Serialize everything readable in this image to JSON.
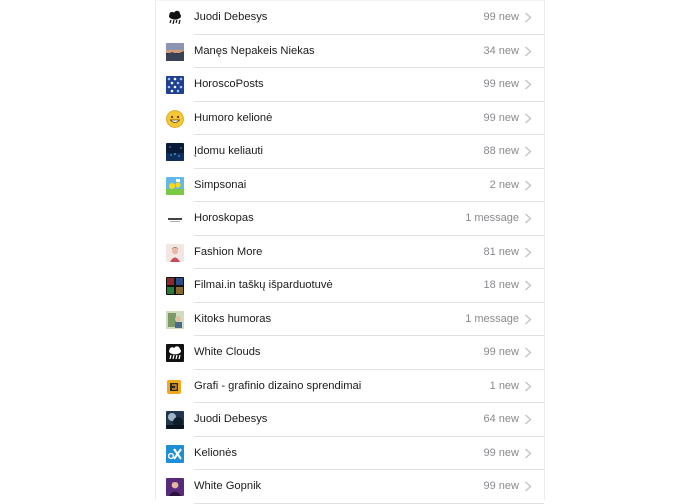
{
  "groups": [
    {
      "title": "Juodi Debesys",
      "count": "99 new",
      "icon": "rain-cloud-icon"
    },
    {
      "title": "Manęs Nepakeis Niekas",
      "count": "34 new",
      "icon": "landscape-icon"
    },
    {
      "title": "HoroscoPosts",
      "count": "99 new",
      "icon": "zodiac-pattern-icon"
    },
    {
      "title": "Humoro kelionė",
      "count": "99 new",
      "icon": "smiley-icon"
    },
    {
      "title": "Įdomu keliauti",
      "count": "88 new",
      "icon": "night-city-icon"
    },
    {
      "title": "Simpsonai",
      "count": "2 new",
      "icon": "simpsons-icon"
    },
    {
      "title": "Horoskopas",
      "count": "1 message",
      "icon": "horoskopas-logo-icon"
    },
    {
      "title": "Fashion More",
      "count": "81 new",
      "icon": "fashion-icon"
    },
    {
      "title": "Filmai.in taškų išparduotuvė",
      "count": "18 new",
      "icon": "movie-grid-icon"
    },
    {
      "title": "Kitoks humoras",
      "count": "1 message",
      "icon": "meme-icon"
    },
    {
      "title": "White Clouds",
      "count": "99 new",
      "icon": "white-cloud-rain-icon"
    },
    {
      "title": "Grafi - grafinio dizaino sprendimai",
      "count": "1 new",
      "icon": "grafi-logo-icon"
    },
    {
      "title": "Juodi Debesys",
      "count": "64 new",
      "icon": "dark-sky-icon"
    },
    {
      "title": "Kelionės",
      "count": "99 new",
      "icon": "travel-x-icon"
    },
    {
      "title": "White Gopnik",
      "count": "99 new",
      "icon": "person-portrait-icon"
    }
  ]
}
